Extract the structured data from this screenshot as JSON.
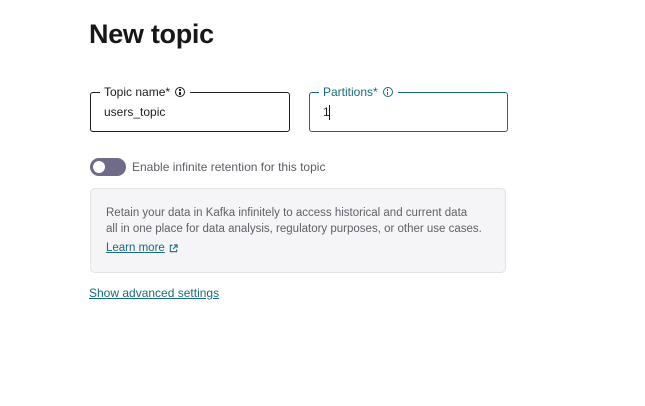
{
  "page": {
    "title": "New topic"
  },
  "form": {
    "topic_name": {
      "label": "Topic name*",
      "value": "users_topic",
      "info_icon": "info-circle-icon"
    },
    "partitions": {
      "label": "Partitions*",
      "value": "1",
      "info_icon": "info-circle-icon",
      "focused": true
    },
    "retention_toggle": {
      "label": "Enable infinite retention for this topic",
      "enabled": false
    }
  },
  "info_box": {
    "line1": "Retain your data in Kafka infinitely to access historical and current data",
    "line2": "all in one place for data analysis, regulatory purposes, or other use cases.",
    "learn_more_label": "Learn more",
    "learn_more_icon": "external-link-icon"
  },
  "advanced": {
    "label": "Show advanced settings"
  },
  "colors": {
    "accent": "#1a6b7d",
    "toggle_off": "#6f6b88",
    "info_box_bg": "#f5f5f7",
    "text_muted": "#5f5f69"
  }
}
